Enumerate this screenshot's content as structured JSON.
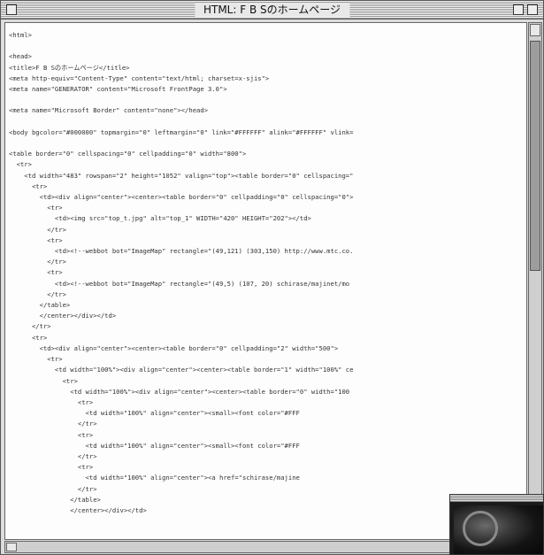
{
  "window": {
    "title": "HTML: F B Sのホームページ"
  },
  "code_lines": [
    "<html>",
    "",
    "<head>",
    "<title>F B Sのホームページ</title>",
    "<meta http-equiv=\"Content-Type\" content=\"text/html; charset=x-sjis\">",
    "<meta name=\"GENERATOR\" content=\"Microsoft FrontPage 3.0\">",
    "",
    "<meta name=\"Microsoft Border\" content=\"none\"></head>",
    "",
    "<body bgcolor=\"#000000\" topmargin=\"0\" leftmargin=\"0\" link=\"#FFFFFF\" alink=\"#FFFFFF\" vlink=",
    "",
    "<table border=\"0\" cellspacing=\"0\" cellpadding=\"0\" width=\"800\">",
    "  <tr>",
    "    <td width=\"483\" rowspan=\"2\" height=\"1052\" valign=\"top\"><table border=\"0\" cellspacing=\"",
    "      <tr>",
    "        <td><div align=\"center\"><center><table border=\"0\" cellpadding=\"0\" cellspacing=\"0\">",
    "          <tr>",
    "            <td><img src=\"top_t.jpg\" alt=\"top_1\" WIDTH=\"420\" HEIGHT=\"202\"></td>",
    "          </tr>",
    "          <tr>",
    "            <td><!--webbot bot=\"ImageMap\" rectangle=\"(49,121) (303,150) http://www.mtc.co.",
    "          </tr>",
    "          <tr>",
    "            <td><!--webbot bot=\"ImageMap\" rectangle=\"(49,5) (107, 20) schirase/majinet/mo",
    "          </tr>",
    "        </table>",
    "        </center></div></td>",
    "      </tr>",
    "      <tr>",
    "        <td><div align=\"center\"><center><table border=\"0\" cellpadding=\"2\" width=\"500\">",
    "          <tr>",
    "            <td width=\"100%\"><div align=\"center\"><center><table border=\"1\" width=\"100%\" ce",
    "              <tr>",
    "                <td width=\"100%\"><div align=\"center\"><center><table border=\"0\" width=\"100",
    "                  <tr>",
    "                    <td width=\"100%\" align=\"center\"><small><font color=\"#FFF",
    "                  </tr>",
    "                  <tr>",
    "                    <td width=\"100%\" align=\"center\"><small><font color=\"#FFF",
    "                  </tr>",
    "                  <tr>",
    "                    <td width=\"100%\" align=\"center\"><a href=\"schirase/majine",
    "                  </tr>",
    "                </table>",
    "                </center></div></td>"
  ],
  "colors": {
    "window_bg": "#dcdcdc",
    "text": "#333333",
    "content_bg": "#fdfdfd"
  }
}
